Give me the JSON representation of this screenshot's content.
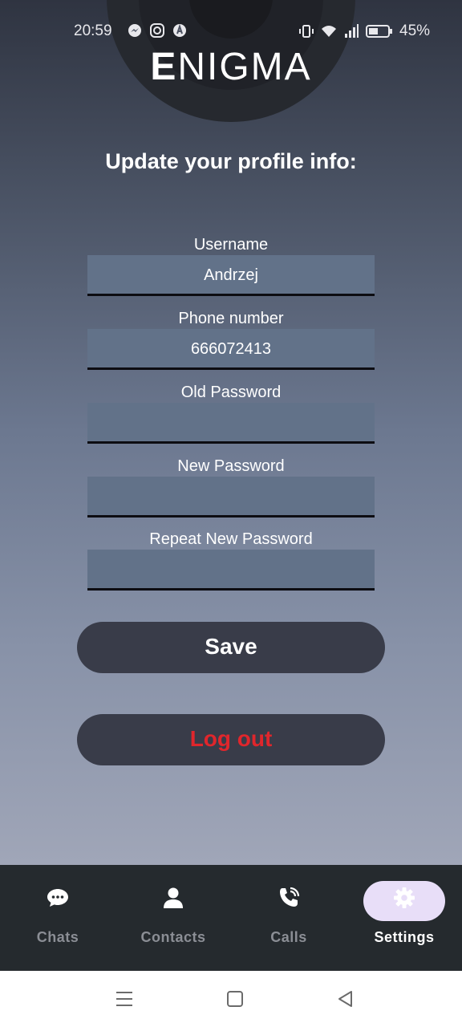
{
  "status_bar": {
    "time": "20:59",
    "notification_icons": [
      "messenger-icon",
      "instagram-icon",
      "app-icon"
    ],
    "battery": "45%"
  },
  "app": {
    "logo_first": "E",
    "logo_rest": "NIGMA"
  },
  "form": {
    "heading": "Update your profile info:",
    "username_label": "Username",
    "username_value": "Andrzej",
    "phone_label": "Phone number",
    "phone_value": "666072413",
    "old_password_label": "Old Password",
    "old_password_value": "",
    "new_password_label": "New Password",
    "new_password_value": "",
    "repeat_password_label": "Repeat New Password",
    "repeat_password_value": "",
    "save_label": "Save",
    "logout_label": "Log out"
  },
  "nav": {
    "items": [
      {
        "label": "Chats",
        "icon": "chat-bubble-icon",
        "active": false
      },
      {
        "label": "Contacts",
        "icon": "person-icon",
        "active": false
      },
      {
        "label": "Calls",
        "icon": "phone-call-icon",
        "active": false
      },
      {
        "label": "Settings",
        "icon": "gear-icon",
        "active": true
      }
    ]
  },
  "colors": {
    "logout_text": "#e0262c",
    "active_pill": "#e8def8",
    "field_bg": "#627289",
    "button_bg": "#393c49"
  }
}
